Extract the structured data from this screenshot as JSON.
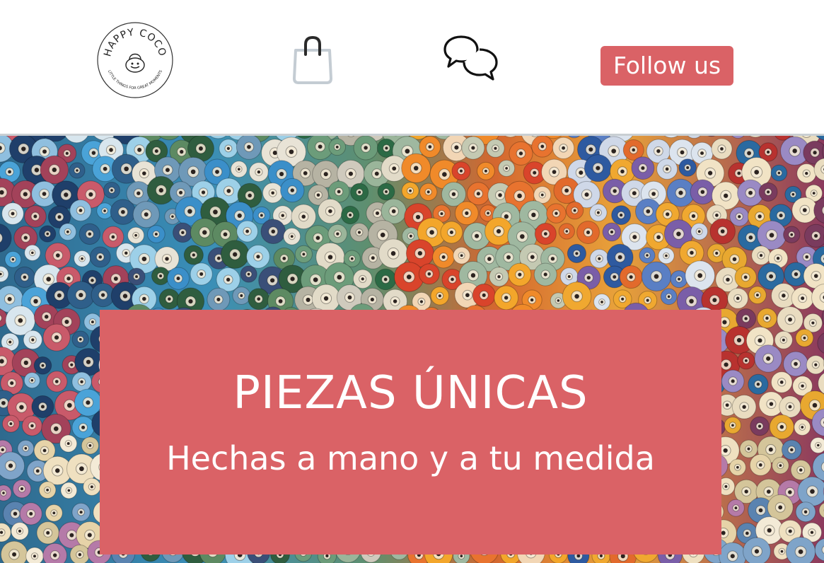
{
  "header": {
    "logo": {
      "brand_text": "HAPPY COCO",
      "tagline": "LITTLE THINGS FOR GREAT MOMENTS",
      "icon": "handbag-logo"
    },
    "shop_icon": "shopping-bag-icon",
    "chat_icon": "chat-bubbles-icon",
    "follow_button_label": "Follow us"
  },
  "hero": {
    "background_image": "colorful-thread-spools",
    "title": "PIEZAS ÚNICAS",
    "subtitle": "Hechas a mano y a tu medida"
  },
  "colors": {
    "accent": "#da6266",
    "divider": "#c9cfd3",
    "bag_icon_stroke": "#c4ccd3"
  }
}
